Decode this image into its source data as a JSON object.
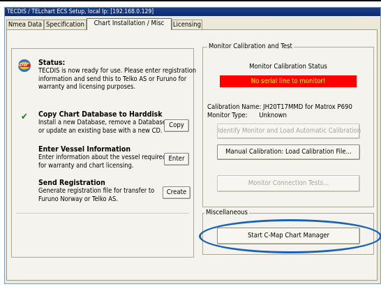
{
  "window": {
    "title": "TECDIS / TELchart ECS Setup,    local Ip: [192.168.0.129]"
  },
  "tabs": [
    {
      "label": "Nmea Data"
    },
    {
      "label": "Specification"
    },
    {
      "label": "Chart Installation / Misc"
    },
    {
      "label": "Licensing"
    }
  ],
  "left": {
    "status": {
      "heading": "Status:",
      "lines": [
        "TECDIS is now ready for use. Please enter registration",
        "information and send this to Telko AS or Furuno for",
        "warranty and licensing purposes."
      ]
    },
    "copy": {
      "heading": "Copy Chart Database to Harddisk",
      "lines": [
        "Install a new Database, remove a Database,",
        "or update an existing base with a new CD."
      ],
      "button": "Copy"
    },
    "vessel": {
      "heading": "Enter Vessel Information",
      "lines": [
        "Enter information about the vessel required",
        "for warranty and chart licensing."
      ],
      "button": "Enter"
    },
    "registration": {
      "heading": "Send Registration",
      "lines": [
        "Generate registration file for transfer to",
        "Furuno Norway or Telko AS."
      ],
      "button": "Create"
    },
    "setup_icon_text": "SETUP"
  },
  "calibration": {
    "group_label": "Monitor Calibration and Test",
    "status_title": "Monitor Calibration Status",
    "status_message": "No serial line to monitor!",
    "calibration_name_label": "Calibration Name:",
    "calibration_name_value": "JH20T17MMD for Matrox P690",
    "monitor_type_label": "Monitor Type:",
    "monitor_type_value": "Unknown",
    "btn_identify": "Identify Monitor and Load Automatic Calibration",
    "btn_manual": "Manual Calibration: Load Calibration File...",
    "btn_tests": "Monitor Connection Tests..."
  },
  "misc": {
    "group_label": "Miscellaneous",
    "btn_cmap": "Start C-Map Chart Manager"
  },
  "colors": {
    "status_bg": "#ff0000",
    "status_text": "#ffff00",
    "highlight_oval": "#1a62b5"
  }
}
